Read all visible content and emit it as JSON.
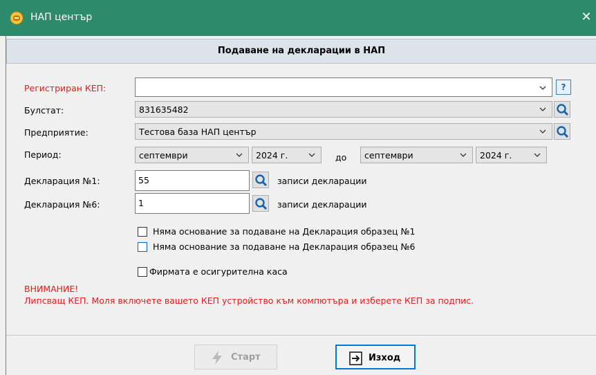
{
  "window": {
    "title": "НАП център",
    "close_glyph": "✕"
  },
  "header": {
    "title": "Подаване на декларации в НАП"
  },
  "form": {
    "kep_label": "Регистриран КЕП:",
    "kep_value": "",
    "bulstat_label": "Булстат:",
    "bulstat_value": "831635482",
    "company_label": "Предприятие:",
    "company_value": "Тестова база НАП център",
    "period_label": "Период:",
    "period_from_month": "септември",
    "period_from_year": "2024 г.",
    "period_to_label": "до",
    "period_to_month": "септември",
    "period_to_year": "2024 г.",
    "decl1_label": "Декларация №1:",
    "decl1_value": "55",
    "decl1_suffix": "записи декларации",
    "decl6_label": "Декларация №6:",
    "decl6_value": "1",
    "decl6_suffix": "записи декларации",
    "help_label": "?"
  },
  "checkboxes": {
    "no_decl1": "Няма основание за подаване на Декларация образец №1",
    "no_decl6": "Няма основание за подаване на Декларация образец №6",
    "insurance_fund": "Фирмата е осигурителна каса"
  },
  "warning": {
    "title": "ВНИМАНИЕ!",
    "message": "Липсващ КЕП. Моля включете вашето КЕП устройство към компютъра и изберете КЕП за подпис."
  },
  "buttons": {
    "start": "Старт",
    "exit": "Изход"
  },
  "colors": {
    "titlebar": "#2d8a6b",
    "warning": "#e21b1b",
    "accent": "#0078d7"
  }
}
